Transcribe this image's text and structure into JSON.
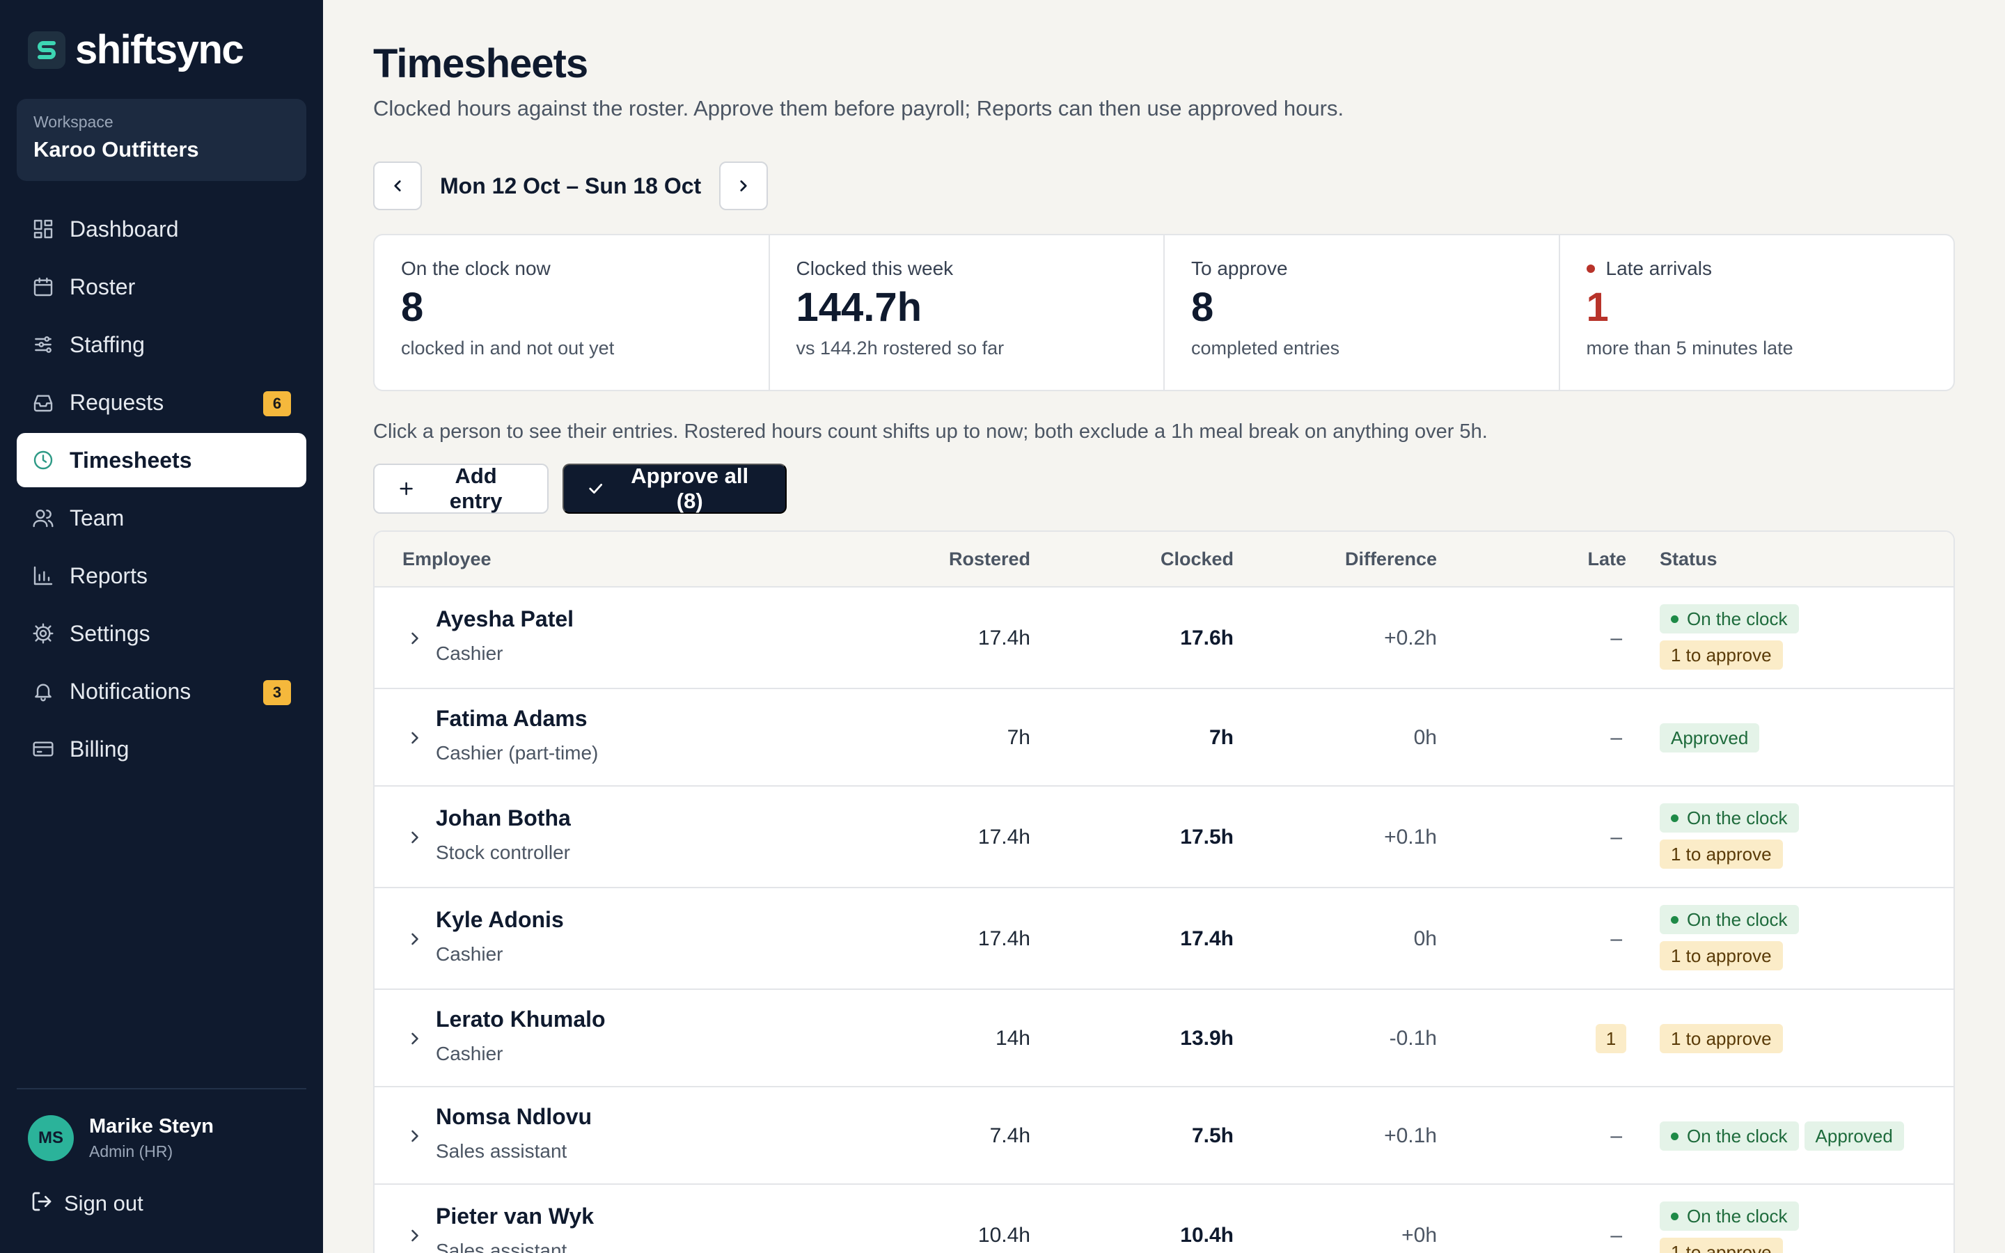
{
  "app": {
    "name": "shiftsync",
    "workspace_label": "Workspace",
    "workspace_name": "Karoo Outfitters"
  },
  "nav": [
    {
      "label": "Dashboard",
      "icon": "dashboard-icon",
      "badge": ""
    },
    {
      "label": "Roster",
      "icon": "calendar-icon",
      "badge": ""
    },
    {
      "label": "Staffing",
      "icon": "sliders-icon",
      "badge": ""
    },
    {
      "label": "Requests",
      "icon": "inbox-icon",
      "badge": "6"
    },
    {
      "label": "Timesheets",
      "icon": "clock-icon",
      "badge": ""
    },
    {
      "label": "Team",
      "icon": "users-icon",
      "badge": ""
    },
    {
      "label": "Reports",
      "icon": "bar-chart-icon",
      "badge": ""
    },
    {
      "label": "Settings",
      "icon": "gear-icon",
      "badge": ""
    },
    {
      "label": "Notifications",
      "icon": "bell-icon",
      "badge": "3"
    },
    {
      "label": "Billing",
      "icon": "credit-card-icon",
      "badge": ""
    }
  ],
  "active_nav": "Timesheets",
  "user": {
    "initials": "MS",
    "name": "Marike Steyn",
    "role": "Admin (HR)"
  },
  "signout_label": "Sign out",
  "page": {
    "title": "Timesheets",
    "subtitle": "Clocked hours against the roster. Approve them before payroll; Reports can then use approved hours.",
    "week_label": "Mon 12 Oct – Sun 18 Oct",
    "hint": "Click a person to see their entries. Rostered hours count shifts up to now; both exclude a 1h meal break on anything over 5h."
  },
  "stats": [
    {
      "label": "On the clock now",
      "value": "8",
      "sub": "clocked in and not out yet",
      "alert": false
    },
    {
      "label": "Clocked this week",
      "value": "144.7h",
      "sub": "vs 144.2h rostered so far",
      "alert": false
    },
    {
      "label": "To approve",
      "value": "8",
      "sub": "completed entries",
      "alert": false
    },
    {
      "label": "Late arrivals",
      "value": "1",
      "sub": "more than 5 minutes late",
      "alert": true
    }
  ],
  "actions": {
    "add_label": "Add entry",
    "approve_label": "Approve all (8)"
  },
  "table": {
    "columns": {
      "employee": "Employee",
      "rostered": "Rostered",
      "clocked": "Clocked",
      "difference": "Difference",
      "late": "Late",
      "status": "Status"
    },
    "rows": [
      {
        "name": "Ayesha Patel",
        "role": "Cashier",
        "rostered": "17.4h",
        "clocked": "17.6h",
        "difference": "+0.2h",
        "late": "–",
        "statuses": [
          {
            "text": "On the clock",
            "kind": "clock"
          },
          {
            "text": "1 to approve",
            "kind": "approve"
          }
        ]
      },
      {
        "name": "Fatima Adams",
        "role": "Cashier (part-time)",
        "rostered": "7h",
        "clocked": "7h",
        "difference": "0h",
        "late": "–",
        "statuses": [
          {
            "text": "Approved",
            "kind": "approved"
          }
        ]
      },
      {
        "name": "Johan Botha",
        "role": "Stock controller",
        "rostered": "17.4h",
        "clocked": "17.5h",
        "difference": "+0.1h",
        "late": "–",
        "statuses": [
          {
            "text": "On the clock",
            "kind": "clock"
          },
          {
            "text": "1 to approve",
            "kind": "approve"
          }
        ]
      },
      {
        "name": "Kyle Adonis",
        "role": "Cashier",
        "rostered": "17.4h",
        "clocked": "17.4h",
        "difference": "0h",
        "late": "–",
        "statuses": [
          {
            "text": "On the clock",
            "kind": "clock"
          },
          {
            "text": "1 to approve",
            "kind": "approve"
          }
        ]
      },
      {
        "name": "Lerato Khumalo",
        "role": "Cashier",
        "rostered": "14h",
        "clocked": "13.9h",
        "difference": "-0.1h",
        "late": "1",
        "statuses": [
          {
            "text": "1 to approve",
            "kind": "approve"
          }
        ]
      },
      {
        "name": "Nomsa Ndlovu",
        "role": "Sales assistant",
        "rostered": "7.4h",
        "clocked": "7.5h",
        "difference": "+0.1h",
        "late": "–",
        "statuses": [
          {
            "text": "On the clock",
            "kind": "clock"
          },
          {
            "text": "Approved",
            "kind": "approved"
          }
        ]
      },
      {
        "name": "Pieter van Wyk",
        "role": "Sales assistant",
        "rostered": "10.4h",
        "clocked": "10.4h",
        "difference": "+0h",
        "late": "–",
        "statuses": [
          {
            "text": "On the clock",
            "kind": "clock"
          },
          {
            "text": "1 to approve",
            "kind": "approve"
          }
        ]
      }
    ]
  },
  "colors": {
    "sidebar_bg": "#0f1a2e",
    "accent_teal": "#2bb39a",
    "badge_amber": "#f5b83c",
    "alert_red": "#b8332a",
    "status_green": "#1e6b3c"
  }
}
